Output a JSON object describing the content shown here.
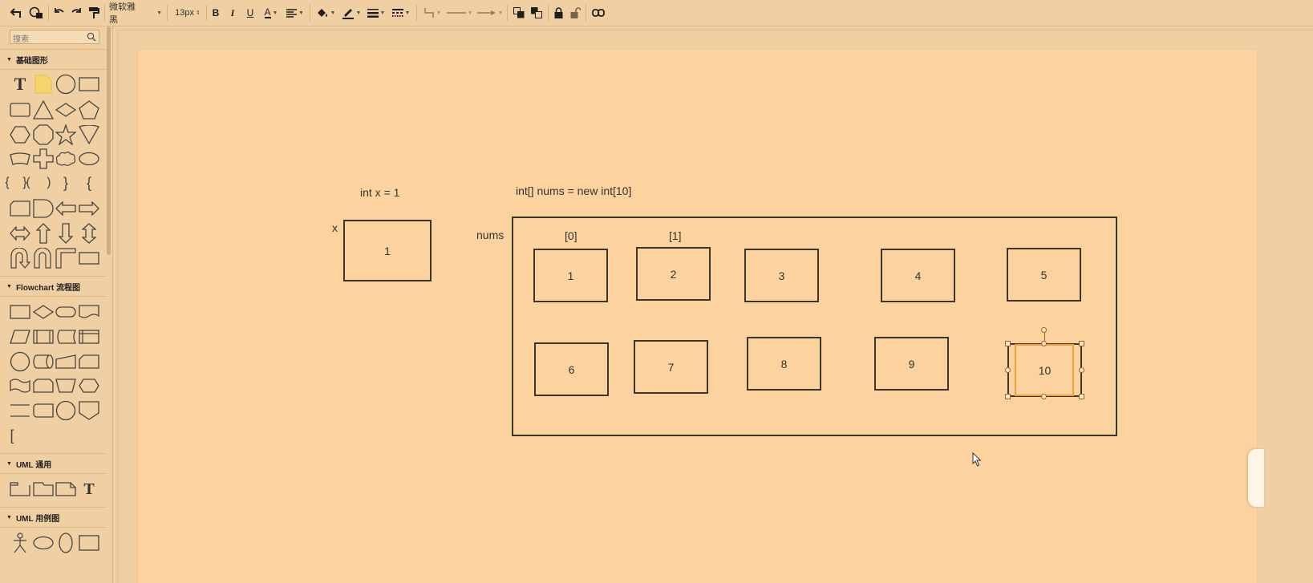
{
  "toolbar": {
    "font_family_value": "微软雅黑",
    "font_size_value": "13px"
  },
  "sidebar": {
    "search_placeholder": "搜索",
    "categories": [
      {
        "label": "基础图形"
      },
      {
        "label": "Flowchart 流程图"
      },
      {
        "label": "UML 通用"
      },
      {
        "label": "UML 用例图"
      }
    ]
  },
  "canvas": {
    "var_label": "int x = 1",
    "var_name": "x",
    "var_value": "1",
    "array_label": "int[]  nums = new int[10]",
    "array_name": "nums",
    "index_labels": [
      "[0]",
      "[1]"
    ],
    "cells": [
      "1",
      "2",
      "3",
      "4",
      "5",
      "6",
      "7",
      "8",
      "9",
      "10"
    ]
  },
  "colors": {
    "background": "#f0d0a2",
    "page": "#fcd39f",
    "stroke": "#3a3630",
    "selection": "#f0a030"
  }
}
